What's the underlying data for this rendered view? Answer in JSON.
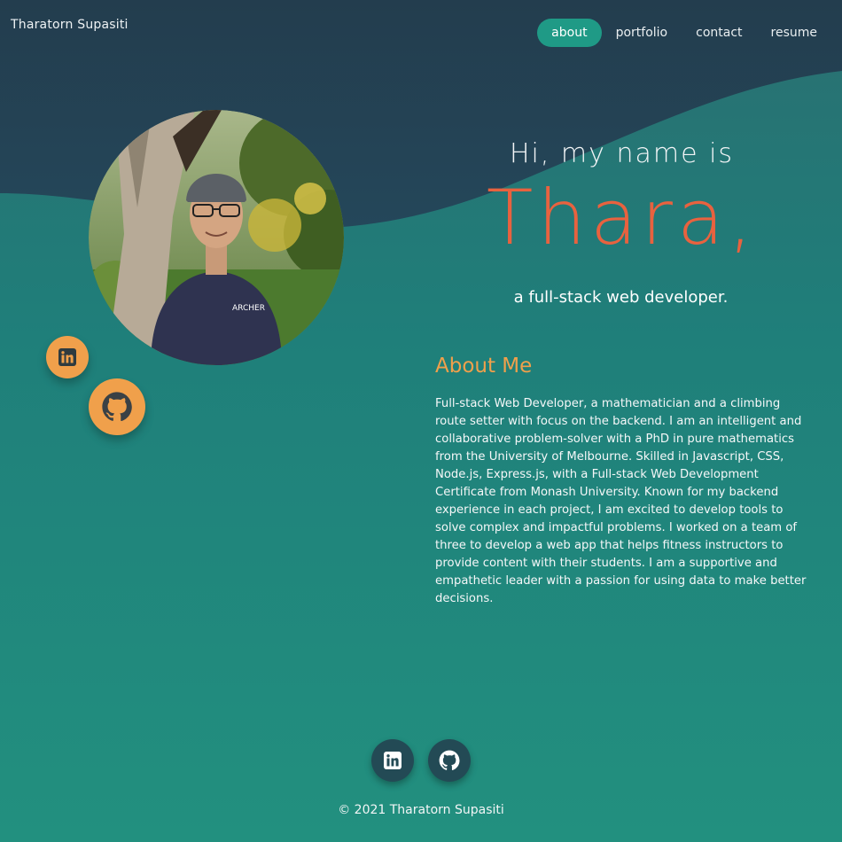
{
  "brand": "Tharatorn Supasiti",
  "nav": [
    {
      "label": "about",
      "active": true
    },
    {
      "label": "portfolio",
      "active": false
    },
    {
      "label": "contact",
      "active": false
    },
    {
      "label": "resume",
      "active": false
    }
  ],
  "hero": {
    "greeting": "Hi, my name is",
    "name": "Thara,",
    "tagline": "a full-stack web developer."
  },
  "about": {
    "title": "About Me",
    "text": "Full-stack Web Developer, a mathematician and a climbing route setter with focus on the backend. I am an intelligent and collaborative problem-solver with a PhD in pure mathematics from the University of Melbourne. Skilled in Javascript, CSS, Node.js, Express.js, with a Full-stack Web Development Certificate from Monash University. Known for my backend experience in each project, I am excited to develop tools to solve complex and impactful problems. I worked on a team of three to develop a web app that helps fitness instructors to provide content with their students. I am a supportive and empathetic leader with a passion for using data to make better decisions."
  },
  "social": {
    "linkedin_icon": "linkedin-icon",
    "github_icon": "github-icon"
  },
  "footer": {
    "copyright": "© 2021 Tharatorn Supasiti"
  },
  "colors": {
    "accent_orange": "#f0a04b",
    "name_orange": "#e8623f",
    "nav_active": "#1f9a86",
    "header_dark": "#234a55"
  }
}
